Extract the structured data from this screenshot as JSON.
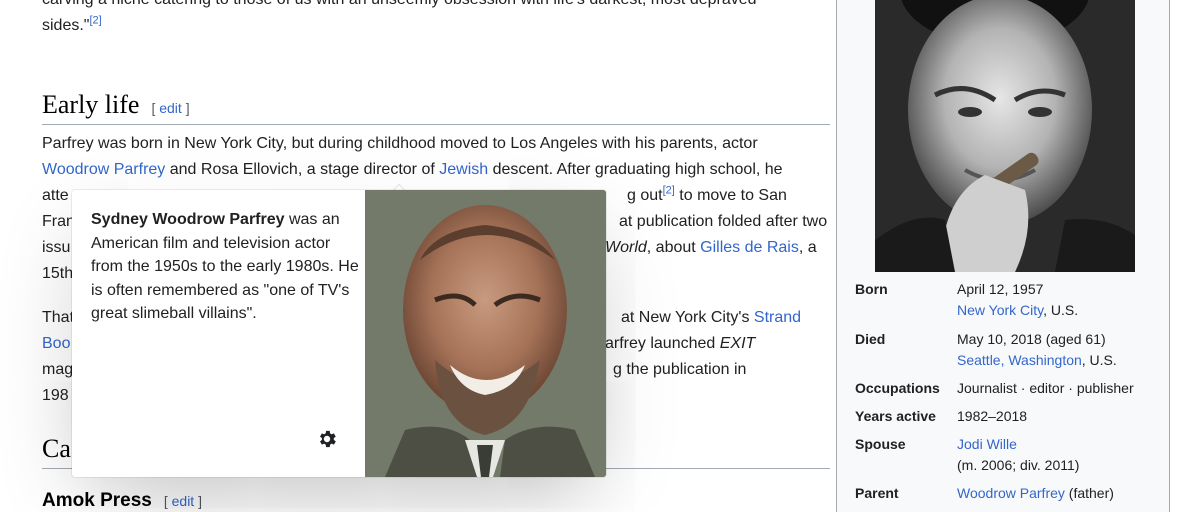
{
  "intro": {
    "line1": "carving a niche catering to those of us with an unseemly obsession with life's darkest, most depraved",
    "line2": "sides.\"",
    "ref": "[2]"
  },
  "early_life": {
    "heading": "Early life",
    "edit": "edit",
    "p1_l1": "Parfrey was born in New York City, but during childhood moved to Los Angeles with his parents, actor",
    "p1_l2_link1": "Woodrow Parfrey",
    "p1_l2_mid": " and Rosa Ellovich, a stage director of ",
    "p1_l2_link2": "Jewish",
    "p1_l2_end": " descent. After graduating high school, he",
    "p1_l3_a": "atte",
    "p1_l3_b": "g out",
    "p1_l3_ref": "[2]",
    "p1_l3_c": " to move to San",
    "p1_l4_a": "Fran",
    "p1_l4_b": "at publication folded after two",
    "p1_l5_a": "issu",
    "p1_l5_b_em": "World",
    "p1_l5_c": ", about ",
    "p1_l5_link": "Gilles de Rais",
    "p1_l5_d": ", a",
    "p1_l6_a": "15th",
    "p2_l1_a": "That",
    "p2_l1_b": "at New York City's ",
    "p2_l1_link": "Strand",
    "p2_l2_a": "Boo",
    "p2_l2_b": "arfrey launched ",
    "p2_l2_em": "EXIT",
    "p2_l3_a": "mag",
    "p2_l3_b": "g the publication in",
    "p2_l4_a": "198"
  },
  "career": {
    "heading_partial": "Ca"
  },
  "amok": {
    "heading": "Amok Press",
    "edit": "edit"
  },
  "popup": {
    "title": "Sydney Woodrow Parfrey",
    "extract": " was an American film and television actor from the 1950s to the early 1980s. He is often remembered as \"one of TV's great slimeball villains\"."
  },
  "infobox": {
    "rows": [
      {
        "label": "Born",
        "value1": "April 12, 1957",
        "value2_link": "New York City",
        "value2_rest": ", U.S."
      },
      {
        "label": "Died",
        "value1": "May 10, 2018 (aged 61)",
        "value2_link": "Seattle, Washington",
        "value2_rest": ", U.S."
      },
      {
        "label": "Occupations",
        "value": "Journalist · editor · publisher"
      },
      {
        "label": "Years active",
        "value": "1982–2018"
      },
      {
        "label": "Spouse",
        "value_link": "Jodi Wille",
        "value2": "(m. 2006; div. 2011)"
      },
      {
        "label": "Parent",
        "value_link": "Woodrow Parfrey",
        "value_rest": " (father)"
      }
    ]
  }
}
